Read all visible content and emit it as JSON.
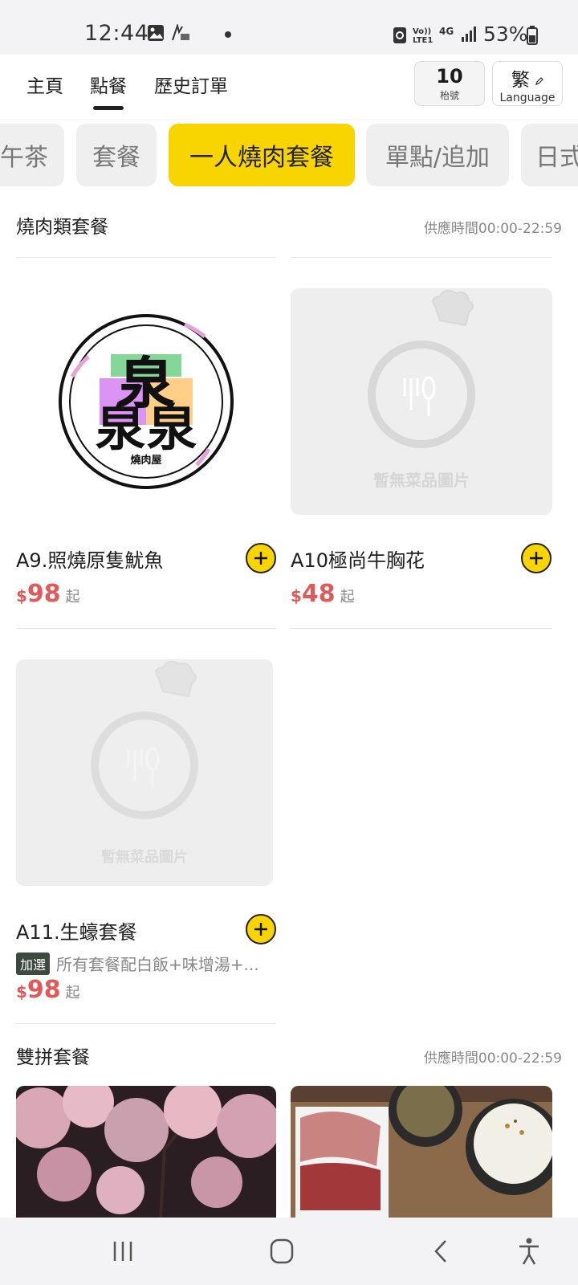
{
  "status_bar": {
    "time": "12:44",
    "network": "Vo)) LTE1",
    "signal_type": "4G",
    "battery": "53%"
  },
  "nav": {
    "tabs": [
      "主頁",
      "點餐",
      "歷史訂單"
    ],
    "active_tab": "點餐",
    "table_number": "10",
    "table_label": "枱號",
    "lang_char": "繁",
    "lang_label": "Language"
  },
  "categories": {
    "items": [
      "午茶",
      "套餐",
      "一人燒肉套餐",
      "單點/追加",
      "日式"
    ],
    "active": "一人燒肉套餐"
  },
  "sections": [
    {
      "title": "燒肉類套餐",
      "time": "供應時間00:00-22:59",
      "items": [
        {
          "name": "A9.照燒原隻魷魚",
          "currency": "$",
          "price": "98",
          "suffix": "起",
          "logo_text": "燒肉屋"
        },
        {
          "name": "A10極尚牛胸花",
          "currency": "$",
          "price": "48",
          "suffix": "起",
          "placeholder_text": "暫無菜品圖片"
        },
        {
          "name": "A11.生蠔套餐",
          "currency": "$",
          "price": "98",
          "suffix": "起",
          "tag": "加選",
          "desc": "所有套餐配白飯+味增湯+...",
          "placeholder_text": "暫無菜品圖片"
        }
      ]
    },
    {
      "title": "雙拼套餐",
      "time": "供應時間00:00-22:59"
    }
  ],
  "colors": {
    "accent": "#f9d500",
    "price": "#e05a5a",
    "tag_bg": "#3d4a3f"
  }
}
